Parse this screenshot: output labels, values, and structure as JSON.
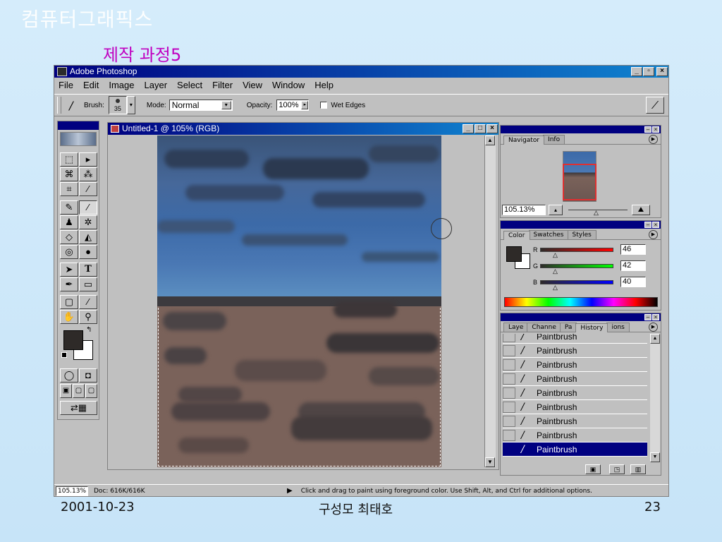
{
  "slide": {
    "title": "컴퓨터그래픽스",
    "subtitle": "제작 과정5",
    "footer_date": "2001-10-23",
    "footer_author": "구성모 최태호",
    "footer_page": "23"
  },
  "app": {
    "title": "Adobe Photoshop",
    "window_controls": {
      "minimize": "_",
      "restore": "▫",
      "close": "×"
    },
    "menu": [
      "File",
      "Edit",
      "Image",
      "Layer",
      "Select",
      "Filter",
      "View",
      "Window",
      "Help"
    ]
  },
  "options_bar": {
    "brush_label": "Brush:",
    "brush_size": "35",
    "mode_label": "Mode:",
    "mode_value": "Normal",
    "opacity_label": "Opacity:",
    "opacity_value": "100%",
    "wet_edges_label": "Wet Edges"
  },
  "document": {
    "title": "Untitled-1 @ 105% (RGB)"
  },
  "navigator": {
    "tabs": [
      "Navigator",
      "Info"
    ],
    "zoom": "105.13%"
  },
  "color_palette": {
    "tabs": [
      "Color",
      "Swatches",
      "Styles"
    ],
    "r_label": "R",
    "r_value": "46",
    "g_label": "G",
    "g_value": "42",
    "b_label": "B",
    "b_value": "40",
    "foreground": "#2e2a28"
  },
  "history_palette": {
    "tabs": [
      "Laye",
      "Channe",
      "Pa",
      "History",
      "ions"
    ],
    "items": [
      "Paintbrush",
      "Paintbrush",
      "Paintbrush",
      "Paintbrush",
      "Paintbrush",
      "Paintbrush",
      "Paintbrush",
      "Paintbrush",
      "Paintbrush"
    ]
  },
  "status_bar": {
    "zoom": "105.13%",
    "doc_size": "Doc: 616K/616K",
    "hint": "Click and drag to paint using foreground color.  Use Shift, Alt, and Ctrl for additional options."
  }
}
